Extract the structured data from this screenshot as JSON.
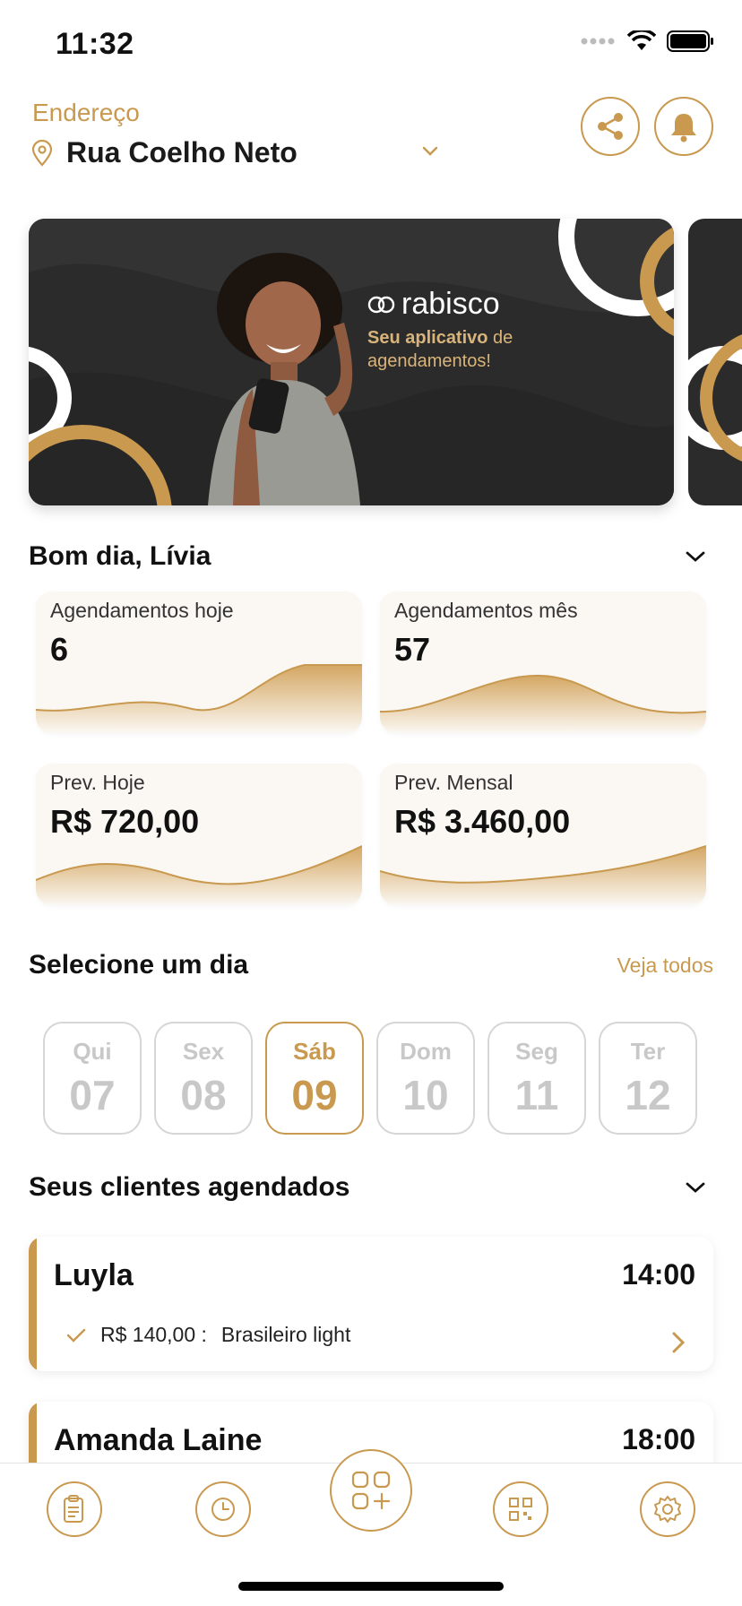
{
  "status_bar": {
    "time": "11:32"
  },
  "header": {
    "address_label": "Endereço",
    "address_value": "Rua Coelho Neto"
  },
  "banner": {
    "brand": "rabisco",
    "tagline_bold": "Seu aplicativo",
    "tagline_rest": " de agendamentos!"
  },
  "greeting": {
    "title": "Bom dia, Lívia"
  },
  "stats": [
    {
      "label": "Agendamentos hoje",
      "value": "6"
    },
    {
      "label": "Agendamentos mês",
      "value": "57"
    },
    {
      "label": "Prev. Hoje",
      "value": "R$ 720,00"
    },
    {
      "label": "Prev. Mensal",
      "value": "R$ 3.460,00"
    }
  ],
  "day_selector": {
    "title": "Selecione um dia",
    "see_all": "Veja todos",
    "days": [
      {
        "name": "Qui",
        "num": "07",
        "selected": false
      },
      {
        "name": "Sex",
        "num": "08",
        "selected": false
      },
      {
        "name": "Sáb",
        "num": "09",
        "selected": true
      },
      {
        "name": "Dom",
        "num": "10",
        "selected": false
      },
      {
        "name": "Seg",
        "num": "11",
        "selected": false
      },
      {
        "name": "Ter",
        "num": "12",
        "selected": false
      }
    ]
  },
  "clients": {
    "title": "Seus clientes agendados",
    "items": [
      {
        "name": "Luyla",
        "time": "14:00",
        "price": "R$ 140,00 :",
        "service": "Brasileiro light"
      },
      {
        "name": "Amanda Laine",
        "time": "18:00"
      }
    ]
  },
  "theme": {
    "accent": "#c8994f",
    "banner_bg": "#2b2b2b"
  },
  "tabbar": {
    "icons": [
      "clipboard-icon",
      "clock-icon",
      "apps-add-icon",
      "qr-code-icon",
      "gear-icon"
    ]
  }
}
